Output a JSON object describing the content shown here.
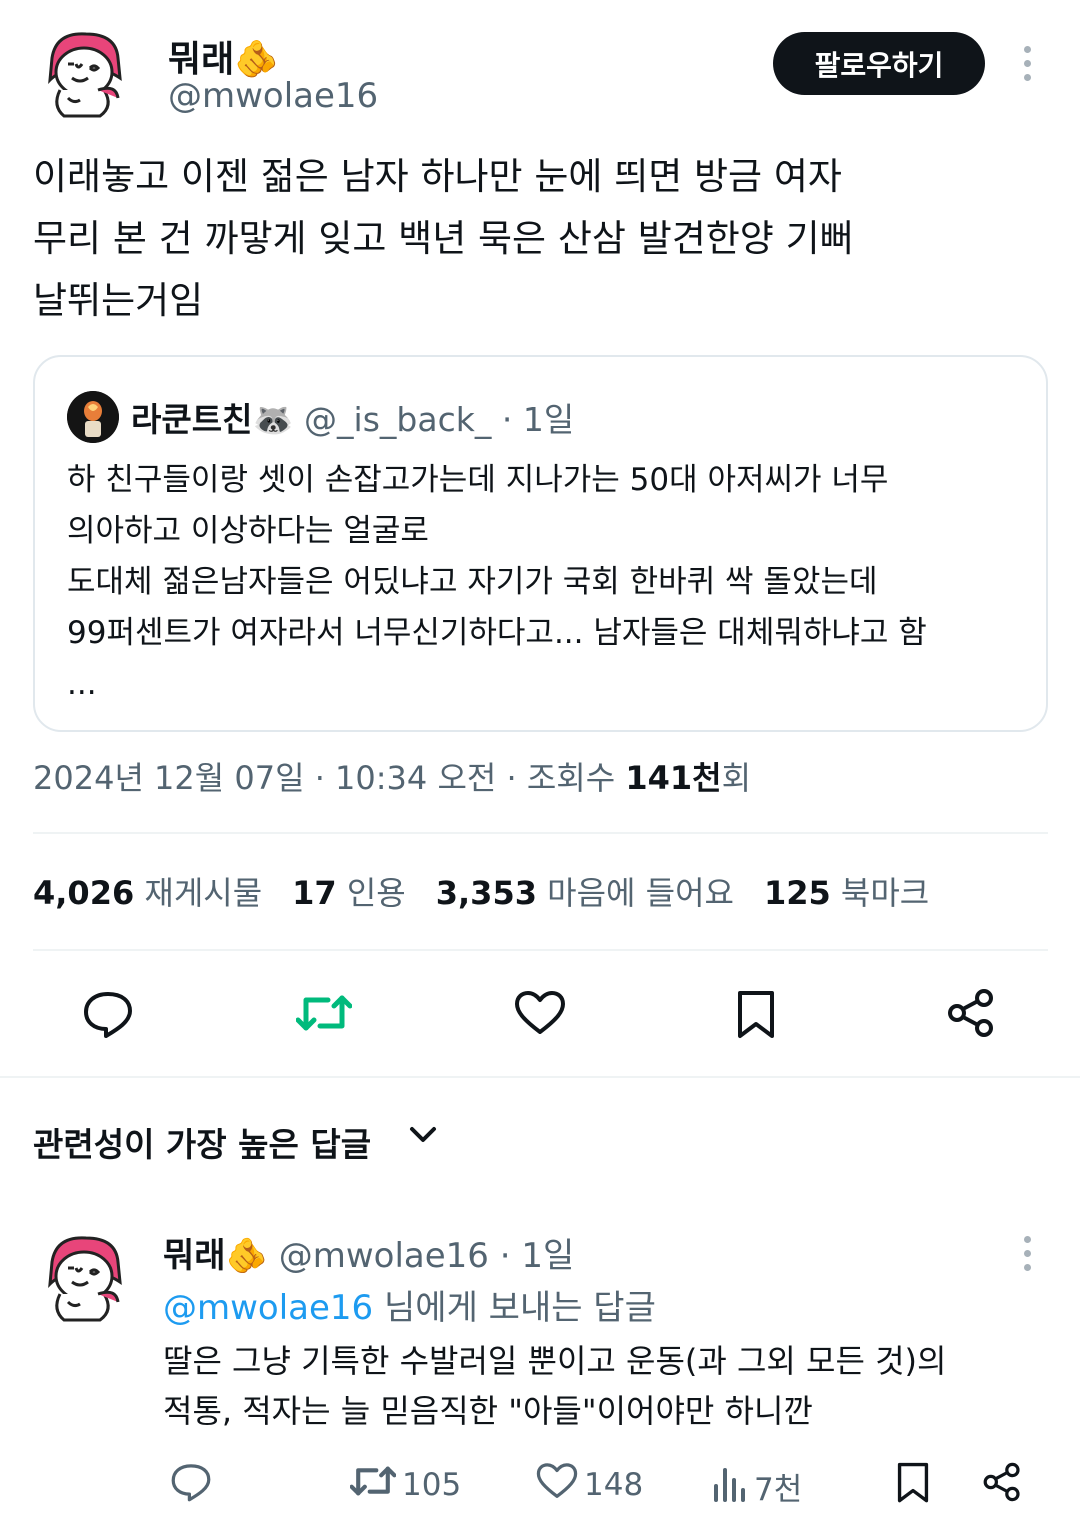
{
  "tweet": {
    "author_name": "뭐래",
    "author_emoji": "🫵",
    "author_handle": "@mwolae16",
    "follow_label": "팔로우하기",
    "text": "이래놓고 이젠 젊은 남자 하나만 눈에 띄면 방금 여자\n무리 본 건 까맣게 잊고 백년 묵은 산삼 발견한양 기뻐\n날뛰는거임",
    "quote": {
      "author_name": "라쿤트친",
      "author_emoji": "🦝",
      "author_handle": "@_is_back_",
      "time": "· 1일",
      "text": "하 친구들이랑 셋이 손잡고가는데 지나가는 50대 아저씨가 너무\n의아하고 이상하다는 얼굴로\n도대체 젊은남자들은 어딨냐고 자기가 국회 한바퀴 싹 돌았는데\n99퍼센트가 여자라서 너무신기하다고... 남자들은 대체뭐하냐고 함\n..."
    },
    "timestamp": "2024년 12월 07일 · 10:34 오전 · 조회수",
    "views_count": "141천",
    "views_suffix": "회",
    "stats": {
      "reposts_num": "4,026",
      "reposts_label": "재게시물",
      "quotes_num": "17",
      "quotes_label": "인용",
      "likes_num": "3,353",
      "likes_label": "마음에 들어요",
      "bookmarks_num": "125",
      "bookmarks_label": "북마크"
    }
  },
  "replies_section": {
    "sort_label": "관련성이 가장 높은 답글"
  },
  "reply": {
    "author_name": "뭐래",
    "author_emoji": "🫵",
    "author_handle": "@mwolae16",
    "time": "· 1일",
    "reply_to_mention": "@mwolae16",
    "reply_to_suffix": " 님에게 보내는 답글",
    "text": "딸은 그냥 기특한 수발러일 뿐이고 운동(과 그외 모든 것)의\n적통, 적자는 늘 믿음직한 \"아들\"이어야만 하니깐",
    "reposts": "105",
    "likes": "148",
    "views": "7천"
  },
  "colors": {
    "text": "#0f1419",
    "muted": "#536471",
    "retweet_green": "#00ba7c",
    "link_blue": "#1d9bf0",
    "avatar_pink": "#e8457a"
  },
  "icons": [
    "kebab-icon",
    "reply-icon",
    "retweet-icon",
    "like-icon",
    "bookmark-icon",
    "share-icon",
    "chevron-down-icon",
    "views-icon"
  ]
}
